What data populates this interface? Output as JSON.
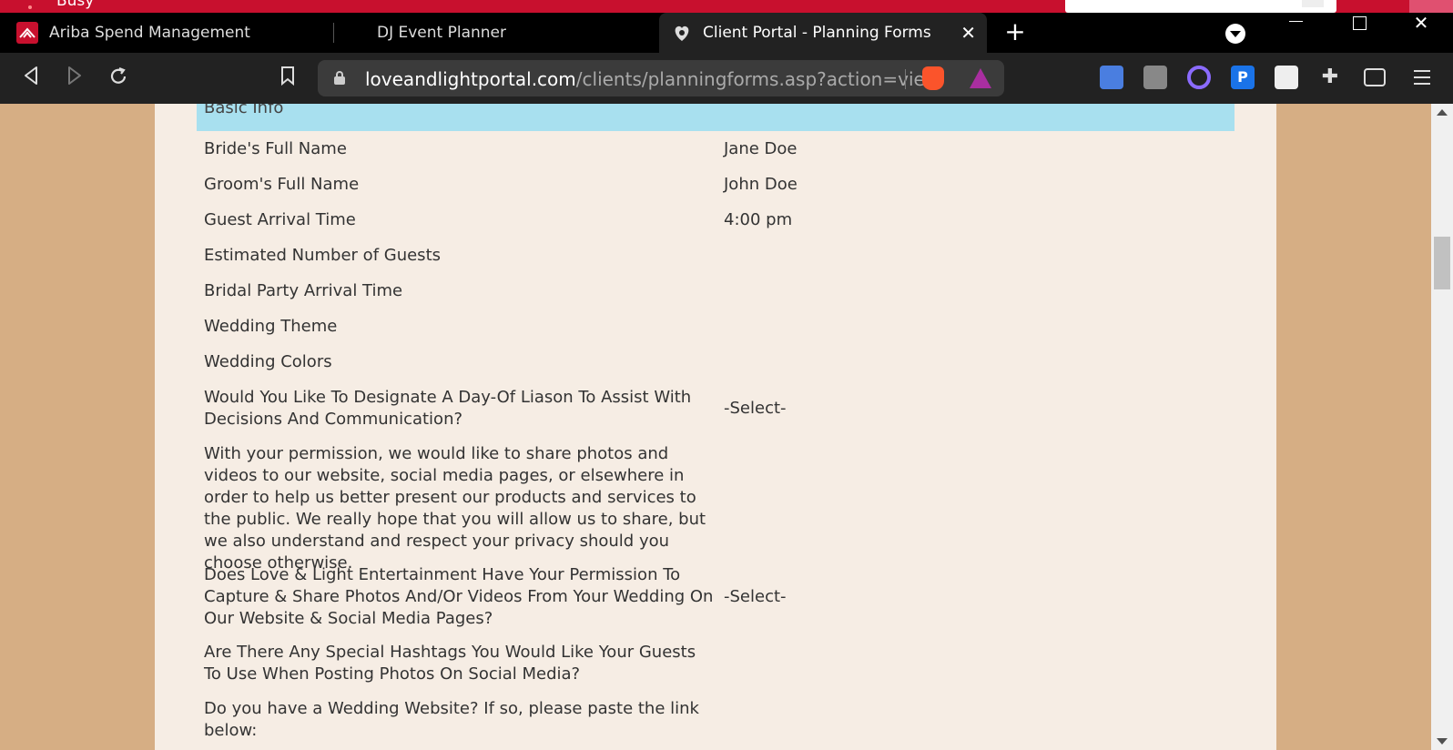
{
  "os_taskbar": {
    "status_text": "Busy"
  },
  "browser": {
    "tabs": [
      {
        "title": "Ariba Spend Management",
        "icon": "ariba-logo-icon"
      },
      {
        "title": "DJ Event Planner",
        "icon": ""
      },
      {
        "title": "Client Portal - Planning Forms",
        "icon": "lovelight-favicon-icon",
        "active": true
      }
    ],
    "new_tab_label": "+",
    "close_tab_label": "✕",
    "address": {
      "host": "loveandlightportal.com",
      "path": "/clients/planningforms.asp?action=vie..."
    },
    "accent_colors": {
      "brave": "#fb542b",
      "tab_strip": "#000000",
      "toolbar": "#222222"
    }
  },
  "page": {
    "section_title": "Basic Info",
    "section_color": "#a8e0ef",
    "background_color": "#d6ae84",
    "panel_color": "#f6ede4",
    "rows": [
      {
        "question": "Bride's Full Name",
        "answer": "Jane Doe"
      },
      {
        "question": "Groom's Full Name",
        "answer": "John Doe"
      },
      {
        "question": "Guest Arrival Time",
        "answer": "4:00 pm"
      },
      {
        "question": "Estimated Number of Guests",
        "answer": ""
      },
      {
        "question": "Bridal Party Arrival Time",
        "answer": ""
      },
      {
        "question": "Wedding Theme",
        "answer": ""
      },
      {
        "question": "Wedding Colors",
        "answer": ""
      },
      {
        "question": "Would You Like To Designate A Day-Of Liason To Assist With Decisions And Communication?",
        "answer": "-Select-"
      },
      {
        "question": "With your permission, we would like to share photos and videos to our website, social media pages, or elsewhere in order to help us better present our products and services to the public. We really hope that you will allow us to share, but we also understand and respect your privacy should you choose otherwise.",
        "answer": ""
      },
      {
        "question": "Does Love & Light Entertainment Have Your Permission To Capture & Share Photos And/Or Videos From Your Wedding On Our Website & Social Media Pages?",
        "answer": "-Select-"
      },
      {
        "question": "Are There Any Special Hashtags You Would Like Your Guests To Use When Posting Photos On Social Media?",
        "answer": ""
      },
      {
        "question": "Do you have a Wedding Website? If so, please paste the link below:",
        "answer": ""
      }
    ]
  }
}
